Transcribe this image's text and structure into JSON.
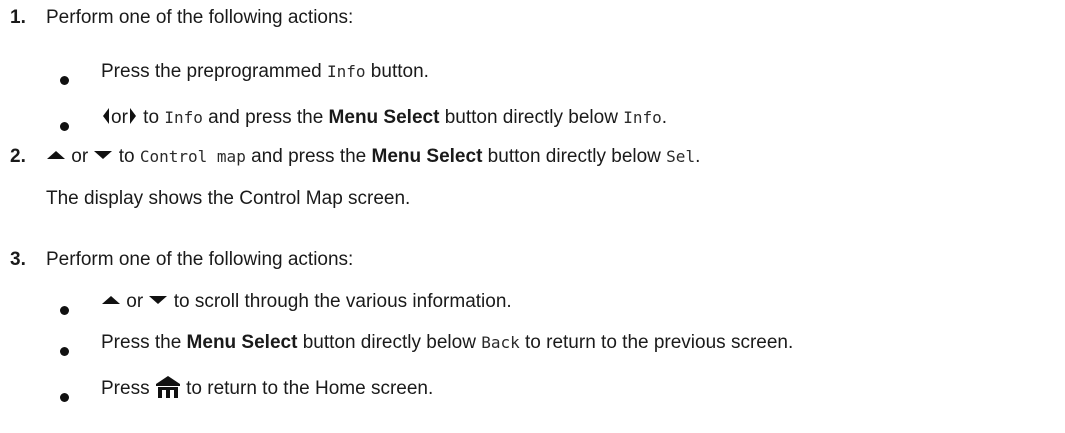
{
  "steps": [
    {
      "number": "1.",
      "text": "Perform one of the following actions:",
      "bullets": [
        {
          "pre": "Press the preprogrammed ",
          "code": "Info",
          "post": " button."
        },
        {
          "or": "or",
          "to": " to ",
          "code1": "Info",
          "mid": " and press the ",
          "bold": "Menu Select",
          "post": " button directly below ",
          "code2": "Info",
          "end": "."
        }
      ]
    },
    {
      "number": "2.",
      "or": " or ",
      "to": " to ",
      "code1": "Control map",
      "mid": " and press the ",
      "bold": "Menu Select",
      "post": " button directly below ",
      "code2": "Sel",
      "end": ".",
      "note": "The display shows the Control Map screen."
    },
    {
      "number": "3.",
      "text": "Perform one of the following actions:",
      "bullets": [
        {
          "or": " or ",
          "post": " to scroll through the various information."
        },
        {
          "pre": "Press the ",
          "bold": "Menu Select",
          "mid": " button directly below ",
          "code": "Back",
          "post": " to return to the previous screen."
        },
        {
          "pre": "Press ",
          "post": " to return to the Home screen."
        }
      ]
    }
  ],
  "icons": {
    "left": "left-arrow-icon",
    "right": "right-arrow-icon",
    "up": "up-arrow-icon",
    "down": "down-arrow-icon",
    "home": "home-icon"
  }
}
